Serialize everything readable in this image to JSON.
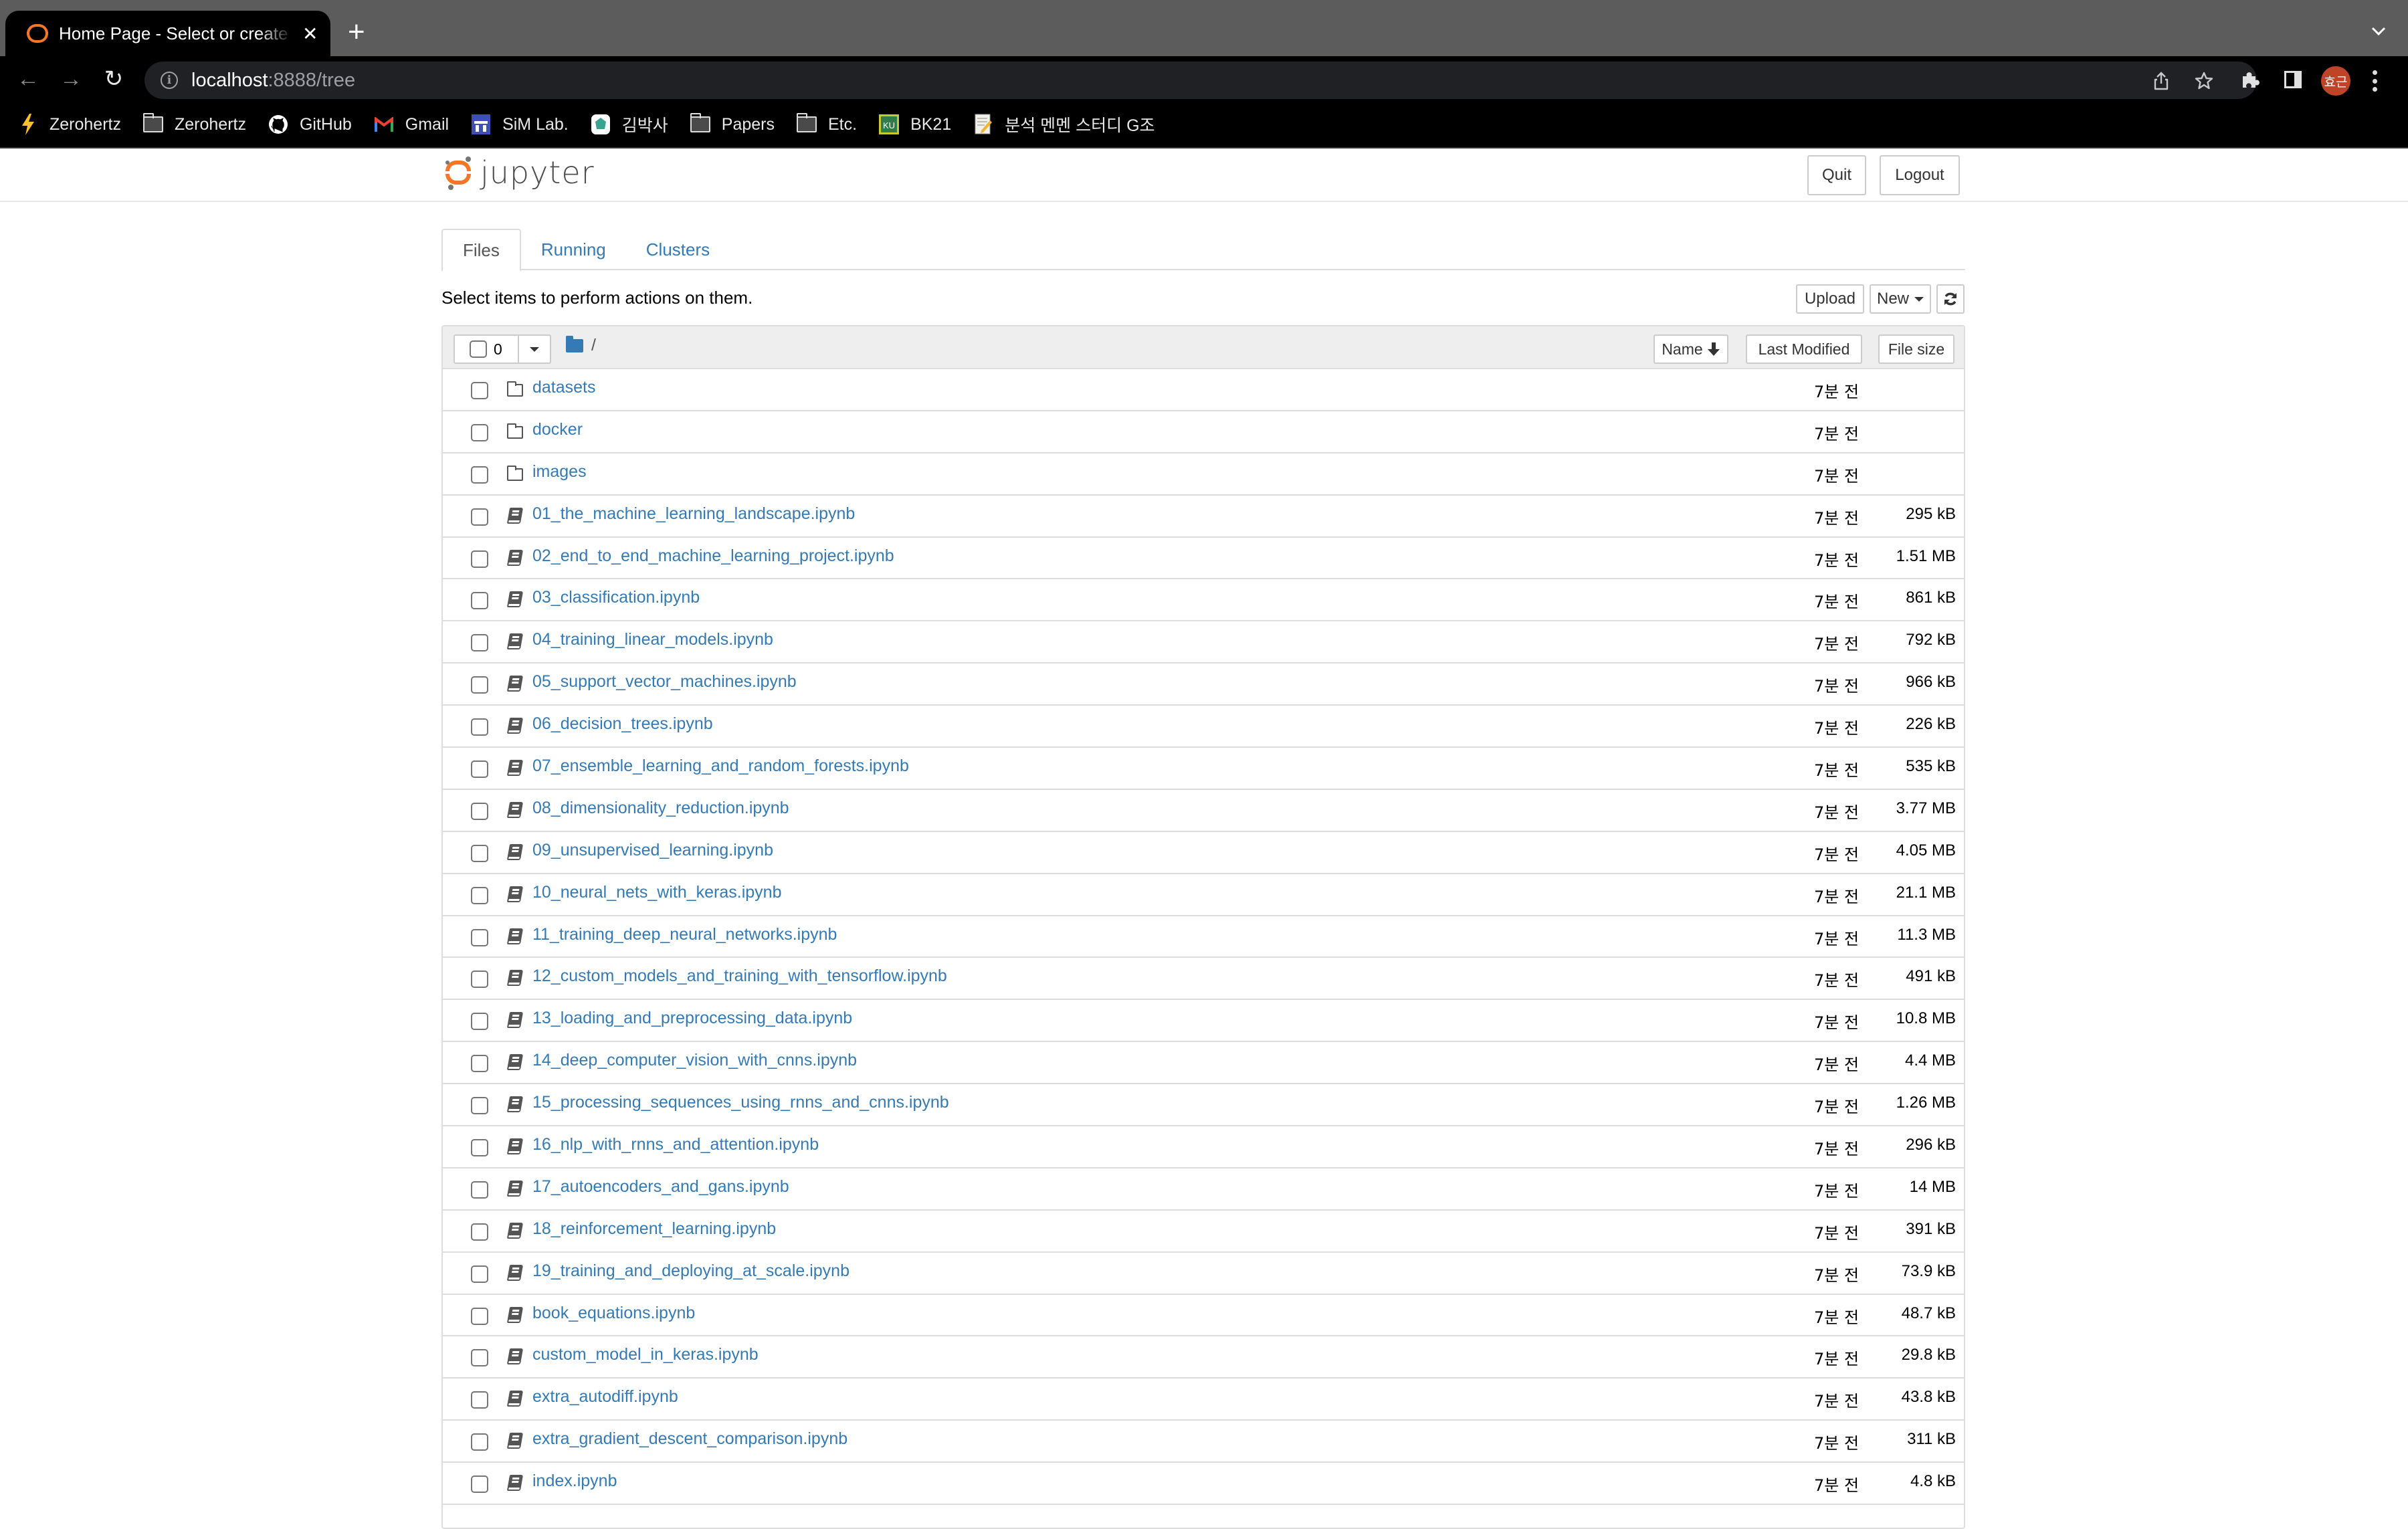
{
  "browser": {
    "tab_title": "Home Page - Select or create a notebook",
    "new_tab_label": "+",
    "url_host": "localhost",
    "url_rest": ":8888/tree",
    "profile_initials": "효근",
    "bookmarks": [
      {
        "label": "Zerohertz",
        "icon": "lightning-icon"
      },
      {
        "label": "Zerohertz",
        "icon": "folder-icon"
      },
      {
        "label": "GitHub",
        "icon": "github-icon"
      },
      {
        "label": "Gmail",
        "icon": "gmail-icon"
      },
      {
        "label": "SiM Lab.",
        "icon": "sim-lab-icon"
      },
      {
        "label": "김박사",
        "icon": "kim-baksa-icon"
      },
      {
        "label": "Papers",
        "icon": "folder-icon"
      },
      {
        "label": "Etc.",
        "icon": "folder-icon"
      },
      {
        "label": "BK21",
        "icon": "ku-icon"
      },
      {
        "label": "분석 멘멘 스터디 G조",
        "icon": "notepad-icon"
      }
    ]
  },
  "header": {
    "logo_text": "jupyter",
    "quit_label": "Quit",
    "logout_label": "Logout"
  },
  "tabs": [
    {
      "label": "Files",
      "active": true
    },
    {
      "label": "Running",
      "active": false
    },
    {
      "label": "Clusters",
      "active": false
    }
  ],
  "toolbar": {
    "hint": "Select items to perform actions on them.",
    "upload_label": "Upload",
    "new_label": "New",
    "refresh_icon": "refresh-icon"
  },
  "list_header": {
    "selected_count": "0",
    "breadcrumb": "/",
    "sort_name_label": "Name",
    "sort_name_arrow": "🡓",
    "sort_modified_label": "Last Modified",
    "sort_size_label": "File size"
  },
  "colors": {
    "link": "#337ab7",
    "jupyter_orange": "#f37726",
    "avatar": "#bf4327"
  },
  "files": [
    {
      "name": "datasets",
      "type": "folder",
      "modified": "7분 전",
      "size": ""
    },
    {
      "name": "docker",
      "type": "folder",
      "modified": "7분 전",
      "size": ""
    },
    {
      "name": "images",
      "type": "folder",
      "modified": "7분 전",
      "size": ""
    },
    {
      "name": "01_the_machine_learning_landscape.ipynb",
      "type": "notebook",
      "modified": "7분 전",
      "size": "295 kB"
    },
    {
      "name": "02_end_to_end_machine_learning_project.ipynb",
      "type": "notebook",
      "modified": "7분 전",
      "size": "1.51 MB"
    },
    {
      "name": "03_classification.ipynb",
      "type": "notebook",
      "modified": "7분 전",
      "size": "861 kB"
    },
    {
      "name": "04_training_linear_models.ipynb",
      "type": "notebook",
      "modified": "7분 전",
      "size": "792 kB"
    },
    {
      "name": "05_support_vector_machines.ipynb",
      "type": "notebook",
      "modified": "7분 전",
      "size": "966 kB"
    },
    {
      "name": "06_decision_trees.ipynb",
      "type": "notebook",
      "modified": "7분 전",
      "size": "226 kB"
    },
    {
      "name": "07_ensemble_learning_and_random_forests.ipynb",
      "type": "notebook",
      "modified": "7분 전",
      "size": "535 kB"
    },
    {
      "name": "08_dimensionality_reduction.ipynb",
      "type": "notebook",
      "modified": "7분 전",
      "size": "3.77 MB"
    },
    {
      "name": "09_unsupervised_learning.ipynb",
      "type": "notebook",
      "modified": "7분 전",
      "size": "4.05 MB"
    },
    {
      "name": "10_neural_nets_with_keras.ipynb",
      "type": "notebook",
      "modified": "7분 전",
      "size": "21.1 MB"
    },
    {
      "name": "11_training_deep_neural_networks.ipynb",
      "type": "notebook",
      "modified": "7분 전",
      "size": "11.3 MB"
    },
    {
      "name": "12_custom_models_and_training_with_tensorflow.ipynb",
      "type": "notebook",
      "modified": "7분 전",
      "size": "491 kB"
    },
    {
      "name": "13_loading_and_preprocessing_data.ipynb",
      "type": "notebook",
      "modified": "7분 전",
      "size": "10.8 MB"
    },
    {
      "name": "14_deep_computer_vision_with_cnns.ipynb",
      "type": "notebook",
      "modified": "7분 전",
      "size": "4.4 MB"
    },
    {
      "name": "15_processing_sequences_using_rnns_and_cnns.ipynb",
      "type": "notebook",
      "modified": "7분 전",
      "size": "1.26 MB"
    },
    {
      "name": "16_nlp_with_rnns_and_attention.ipynb",
      "type": "notebook",
      "modified": "7분 전",
      "size": "296 kB"
    },
    {
      "name": "17_autoencoders_and_gans.ipynb",
      "type": "notebook",
      "modified": "7분 전",
      "size": "14 MB"
    },
    {
      "name": "18_reinforcement_learning.ipynb",
      "type": "notebook",
      "modified": "7분 전",
      "size": "391 kB"
    },
    {
      "name": "19_training_and_deploying_at_scale.ipynb",
      "type": "notebook",
      "modified": "7분 전",
      "size": "73.9 kB"
    },
    {
      "name": "book_equations.ipynb",
      "type": "notebook",
      "modified": "7분 전",
      "size": "48.7 kB"
    },
    {
      "name": "custom_model_in_keras.ipynb",
      "type": "notebook",
      "modified": "7분 전",
      "size": "29.8 kB"
    },
    {
      "name": "extra_autodiff.ipynb",
      "type": "notebook",
      "modified": "7분 전",
      "size": "43.8 kB"
    },
    {
      "name": "extra_gradient_descent_comparison.ipynb",
      "type": "notebook",
      "modified": "7분 전",
      "size": "311 kB"
    },
    {
      "name": "index.ipynb",
      "type": "notebook",
      "modified": "7분 전",
      "size": "4.8 kB"
    }
  ]
}
